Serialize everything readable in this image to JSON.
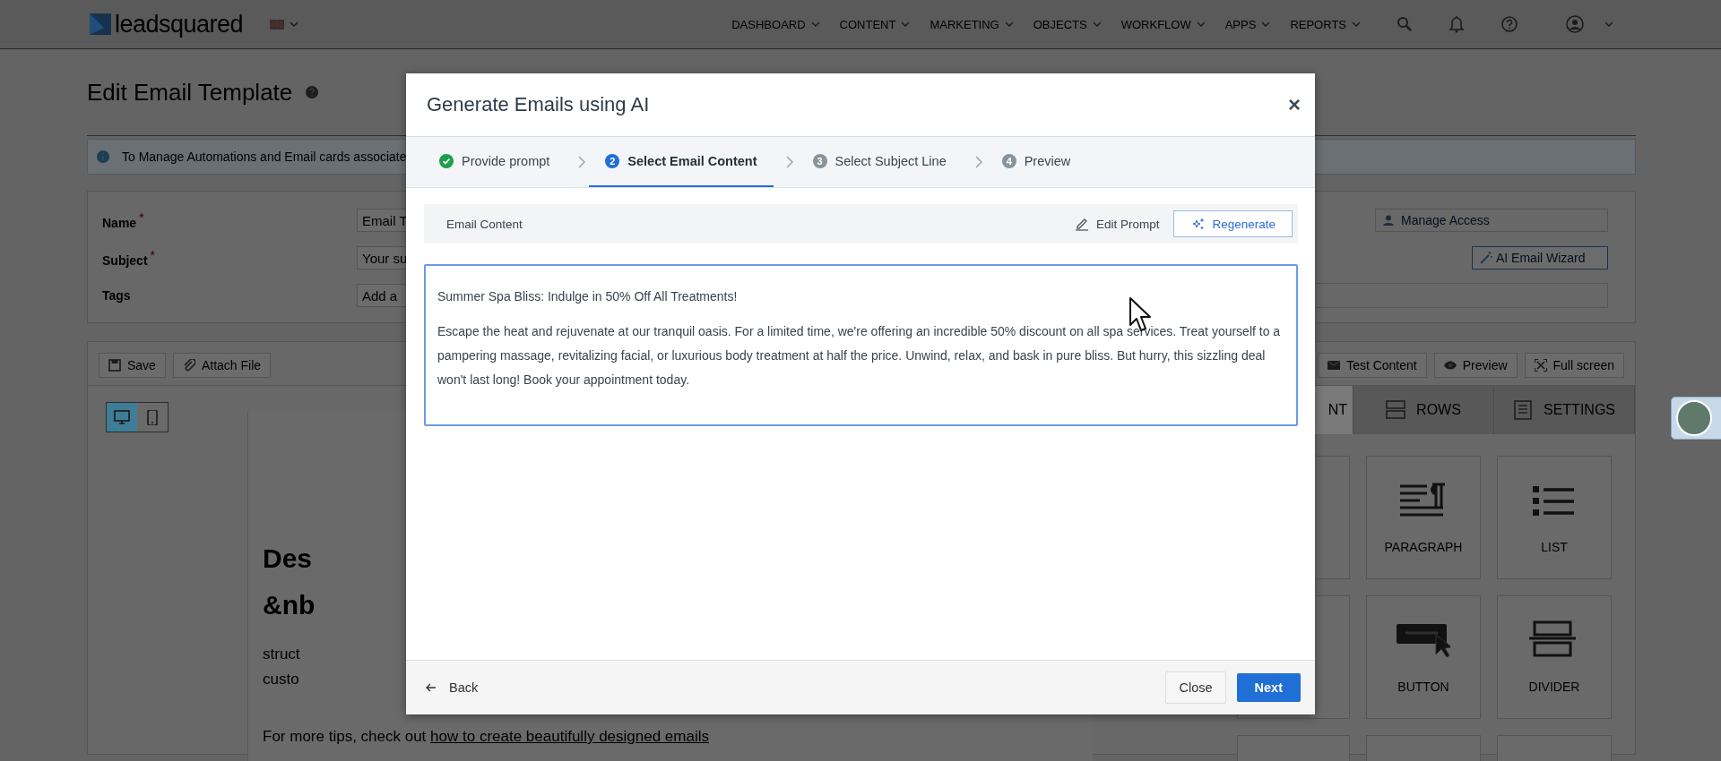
{
  "top_nav": {
    "logo": "leadsquared",
    "items": [
      {
        "label": "DASHBOARD"
      },
      {
        "label": "CONTENT"
      },
      {
        "label": "MARKETING"
      },
      {
        "label": "OBJECTS"
      },
      {
        "label": "WORKFLOW"
      },
      {
        "label": "APPS"
      },
      {
        "label": "REPORTS"
      }
    ]
  },
  "page": {
    "title": "Edit Email Template",
    "info_banner": "To Manage Automations and Email cards associate",
    "form": {
      "fields": [
        {
          "label": "Name",
          "required_mark": "*",
          "value": "Email T"
        },
        {
          "label": "Subject",
          "required_mark": "*",
          "placeholder": "Your su"
        },
        {
          "label": "Tags",
          "placeholder": "Add a"
        }
      ],
      "manage_access": "Manage Access",
      "ai_wizard": "AI Email Wizard"
    },
    "editor": {
      "left_buttons": [
        "Save",
        "Attach File"
      ],
      "right_buttons": [
        "Test Content",
        "Preview",
        "Full screen"
      ],
      "device_toggle": [
        {
          "selected": true
        },
        {
          "selected": false
        }
      ],
      "sidebar_tabs": [
        {
          "label": "NT",
          "selected": true
        },
        {
          "label": "ROWS",
          "selected": false
        },
        {
          "label": "SETTINGS",
          "selected": false
        }
      ],
      "tiles": [
        {
          "label": "PARAGRAPH"
        },
        {
          "label": "LIST"
        },
        {
          "label": "BUTTON"
        },
        {
          "label": "DIVIDER"
        }
      ],
      "canvas": {
        "heading_lines": [
          "Des",
          "&nb"
        ],
        "text_lines": [
          "struct",
          "custo"
        ],
        "tips": "For more tips, check out ",
        "tips_link": "how to create beautifully designed emails"
      }
    }
  },
  "modal": {
    "title": "Generate Emails using AI",
    "close": "×",
    "steps": [
      {
        "label": "Provide prompt",
        "completed": true,
        "selected": false
      },
      {
        "number": "2",
        "label": "Select Email Content",
        "completed": false,
        "selected": true
      },
      {
        "number": "3",
        "label": "Select Subject Line",
        "completed": false,
        "selected": false
      },
      {
        "number": "4",
        "label": "Preview",
        "completed": false,
        "selected": false
      }
    ],
    "content_header": "Email Content",
    "edit_prompt": "Edit Prompt",
    "regenerate": "Regenerate",
    "email_subject": "Summer Spa Bliss: Indulge in 50% Off All Treatments!",
    "email_body": "Escape the heat and rejuvenate at our tranquil oasis. For a limited time, we're offering an incredible 50% discount on all spa services. Treat yourself to a pampering massage, revitalizing facial, or luxurious body treatment at half the price. Unwind, relax, and bask in pure bliss. But hurry, this sizzling deal won't last long! Book your appointment today.",
    "back": "Back",
    "close_button": "Close",
    "next": "Next"
  }
}
